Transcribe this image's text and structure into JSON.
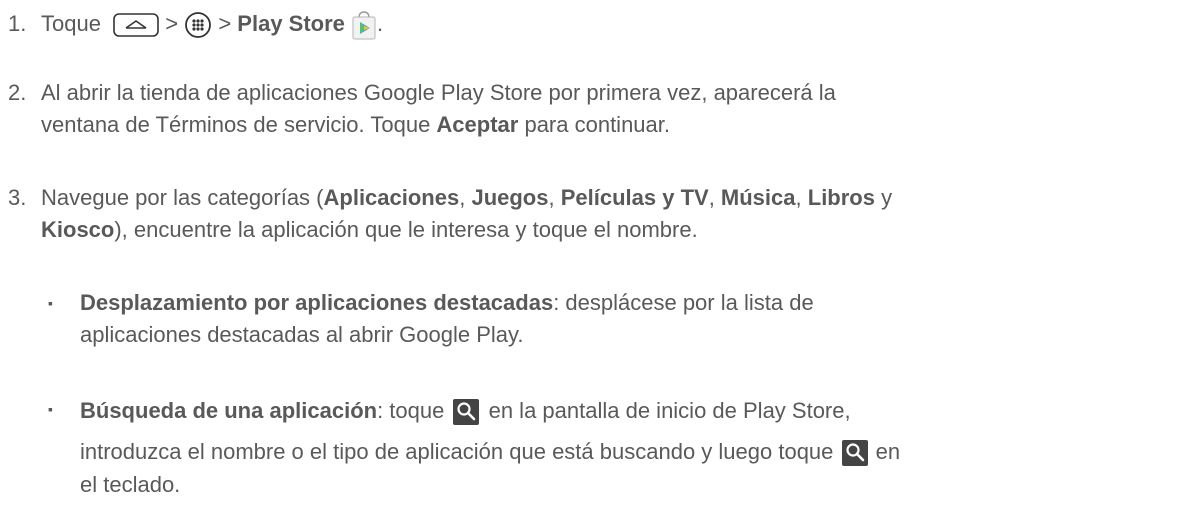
{
  "steps": [
    {
      "num": "1.",
      "a": "Toque",
      "sep1": ">",
      "sep2": ">",
      "app": "Play Store",
      "end": "."
    },
    {
      "num": "2.",
      "line1": "Al abrir la tienda de aplicaciones Google Play Store por primera vez, aparecerá la",
      "line2_a": "ventana de Términos de servicio. Toque ",
      "line2_b": "Aceptar",
      "line2_c": " para continuar."
    },
    {
      "num": "3.",
      "p1": "Navegue por las categorías (",
      "c1": "Aplicaciones",
      "s1": ", ",
      "c2": "Juegos",
      "s2": ", ",
      "c3": "Películas y TV",
      "s3": ", ",
      "c4": "Música",
      "s4": ", ",
      "c5": "Libros",
      "s5": " y",
      "c6": "Kiosco",
      "p2": "), encuentre la aplicación que le interesa y toque el nombre."
    }
  ],
  "bullets": [
    {
      "mark": "▪",
      "title": "Desplazamiento por aplicaciones destacadas",
      "t1": ": desplácese por la lista de",
      "t2": "aplicaciones destacadas al abrir Google Play."
    },
    {
      "mark": "▪",
      "title": "Búsqueda de una aplicación",
      "t1": ": toque",
      "t2": " en la pantalla de inicio de Play Store,",
      "t3": "introduzca el nombre o el tipo de aplicación que está buscando y luego toque",
      "t4": " en",
      "t5": "el teclado."
    }
  ]
}
